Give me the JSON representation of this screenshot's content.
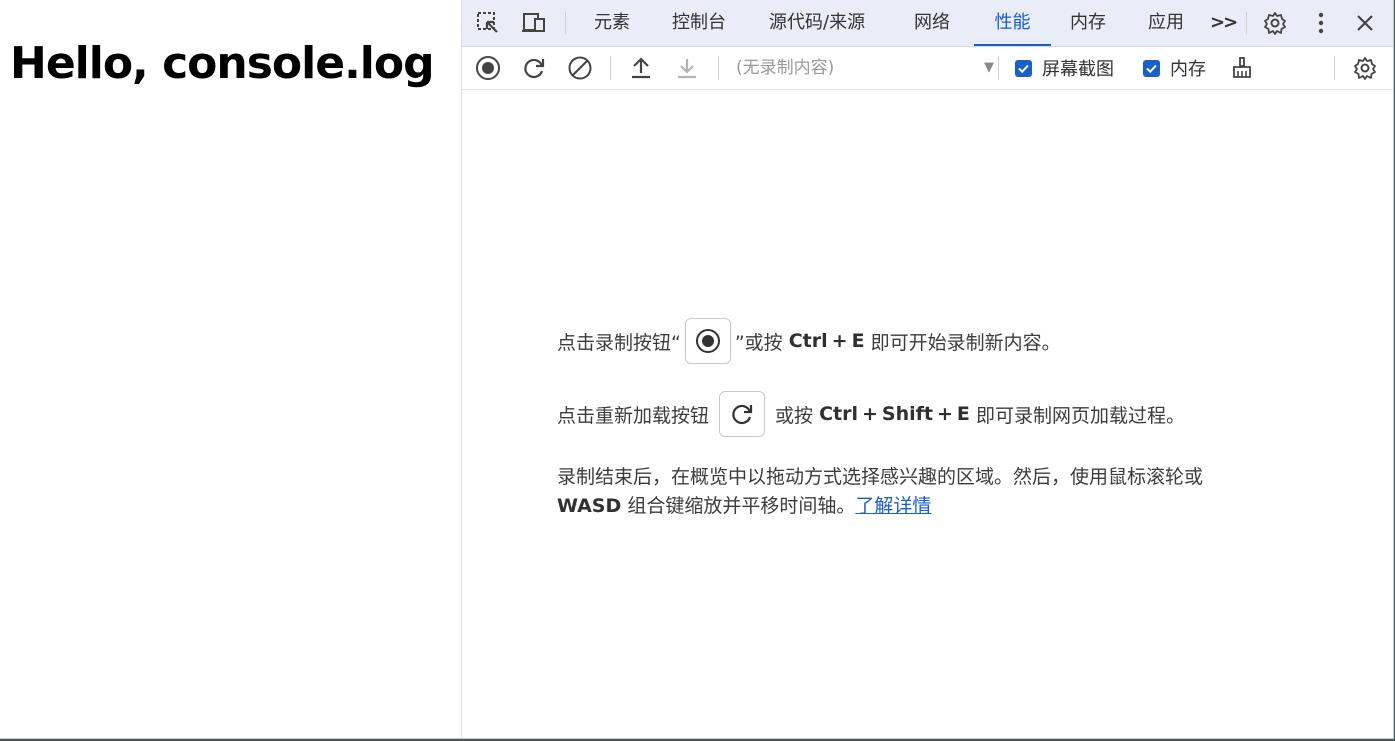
{
  "page": {
    "heading": "Hello, console.log"
  },
  "devtools": {
    "tabs": [
      {
        "label": "元素",
        "active": false
      },
      {
        "label": "控制台",
        "active": false
      },
      {
        "label": "源代码/来源",
        "active": false
      },
      {
        "label": "网络",
        "active": false
      },
      {
        "label": "性能",
        "active": true
      },
      {
        "label": "内存",
        "active": false
      },
      {
        "label": "应用",
        "active": false
      }
    ],
    "more_tabs_glyph": ">>",
    "toolbar": {
      "recording_select": "(无录制内容)",
      "screenshots_label": "屏幕截图",
      "screenshots_checked": true,
      "memory_label": "内存",
      "memory_checked": true
    },
    "landing": {
      "record_prefix": "点击录制按钮“",
      "record_suffix": "”或按",
      "record_key1": "Ctrl",
      "record_key2": "E",
      "record_end": "即可开始录制新内容。",
      "reload_prefix": "点击重新加载按钮",
      "reload_suffix": "或按",
      "reload_key1": "Ctrl",
      "reload_key2": "Shift",
      "reload_key3": "E",
      "reload_end": "即可录制网页加载过程。",
      "plus": "+",
      "para_text": "录制结束后，在概览中以拖动方式选择感兴趣的区域。然后，使用鼠标滚轮或",
      "para_key": "WASD",
      "para_text2": "组合键缩放并平移时间轴。",
      "learn_more": "了解详情"
    },
    "colors": {
      "accent": "#1a5ec8",
      "tabbar_bg": "#e8edf7"
    }
  }
}
